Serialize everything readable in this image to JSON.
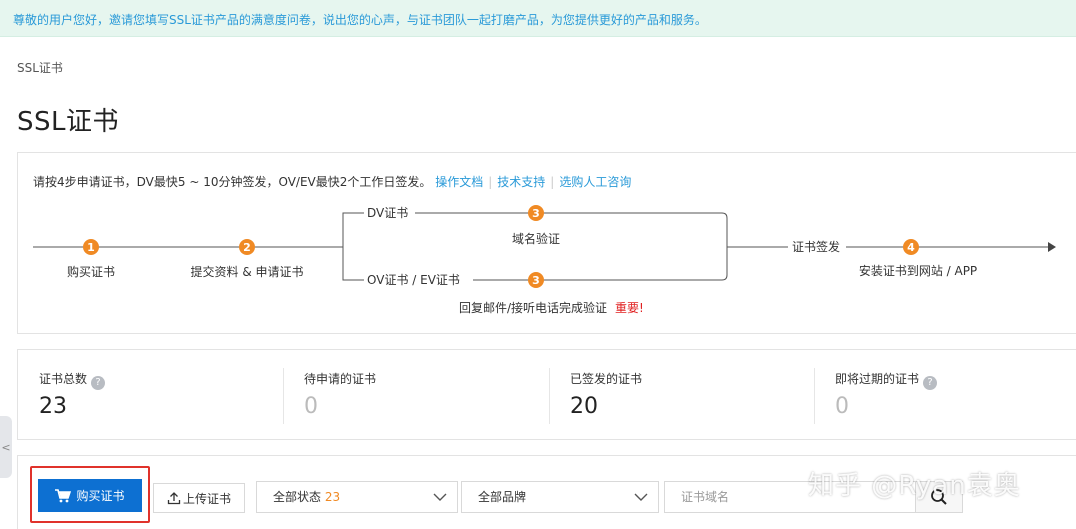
{
  "banner": {
    "text": "尊敬的用户您好，邀请您填写SSL证书产品的满意度问卷，说出您的心声，与证书团队一起打磨产品，为您提供更好的产品和服务。"
  },
  "breadcrumb": "SSL证书",
  "page_title": "SSL证书",
  "steps": {
    "intro": "请按4步申请证书，DV最快5 ~ 10分钟签发，OV/EV最快2个工作日签发。",
    "links": [
      "操作文档",
      "技术支持",
      "选购人工咨询"
    ],
    "step1_num": "1",
    "step1_label": "购买证书",
    "step2_num": "2",
    "step2_label": "提交资料 & 申请证书",
    "dv_label": "DV证书",
    "dv_num": "3",
    "dv_desc": "域名验证",
    "ovev_label": "OV证书 / EV证书",
    "ovev_num": "3",
    "ovev_desc": "回复邮件/接听电话完成验证",
    "ovev_important": "重要!",
    "issue_label": "证书签发",
    "step4_num": "4",
    "step4_label": "安装证书到网站 / APP",
    "accent": "#f08a24"
  },
  "stats": [
    {
      "label": "证书总数",
      "value": "23",
      "help": "?"
    },
    {
      "label": "待申请的证书",
      "value": "0"
    },
    {
      "label": "已签发的证书",
      "value": "20"
    },
    {
      "label": "即将过期的证书",
      "value": "0",
      "help": "?"
    }
  ],
  "toolbar": {
    "buy_label": "购买证书",
    "upload_label": "上传证书",
    "status_select": {
      "label": "全部状态",
      "count": "23"
    },
    "brand_select": {
      "label": "全部品牌"
    },
    "search_placeholder": "证书域名",
    "primary_color": "#0d70d2",
    "highlight_color": "#e0322b"
  },
  "side_toggle": "<",
  "watermark": "知乎 @Ryan袁奥"
}
